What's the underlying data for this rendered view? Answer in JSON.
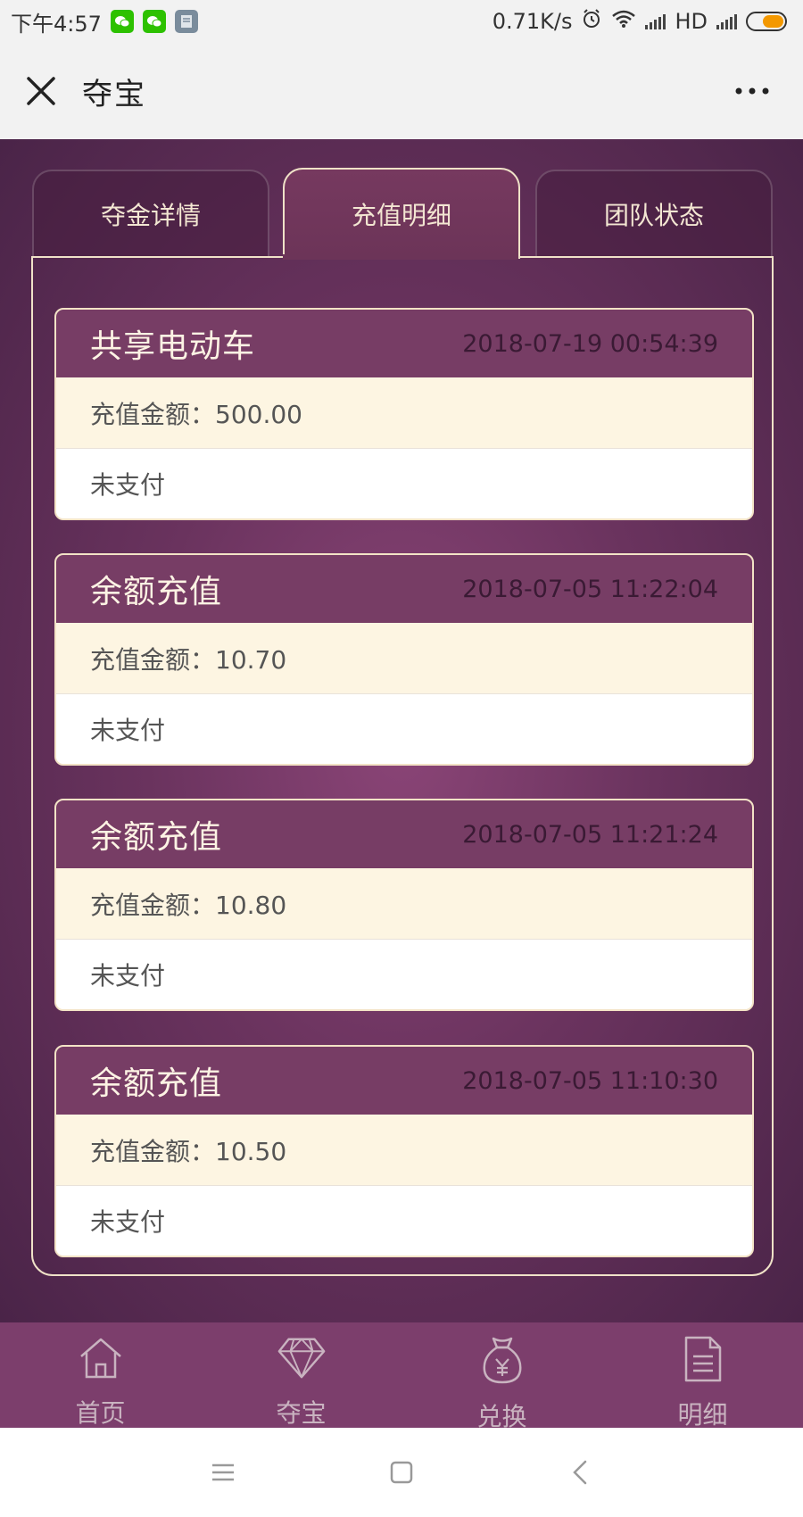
{
  "status_bar": {
    "time": "下午4:57",
    "network_speed": "0.71K/s",
    "network_type": "HD"
  },
  "title_bar": {
    "title": "夺宝"
  },
  "tabs": [
    {
      "label": "夺金详情",
      "active": false
    },
    {
      "label": "充值明细",
      "active": true
    },
    {
      "label": "团队状态",
      "active": false
    }
  ],
  "records": [
    {
      "title": "共享电动车",
      "time": "2018-07-19 00:54:39",
      "amount": "充值金额：500.00",
      "status": "未支付"
    },
    {
      "title": "余额充值",
      "time": "2018-07-05 11:22:04",
      "amount": "充值金额：10.70",
      "status": "未支付"
    },
    {
      "title": "余额充值",
      "time": "2018-07-05 11:21:24",
      "amount": "充值金额：10.80",
      "status": "未支付"
    },
    {
      "title": "余额充值",
      "time": "2018-07-05 11:10:30",
      "amount": "充值金额：10.50",
      "status": "未支付"
    }
  ],
  "bottom_nav": [
    {
      "label": "首页",
      "icon": "home-icon"
    },
    {
      "label": "夺宝",
      "icon": "diamond-icon"
    },
    {
      "label": "兑换",
      "icon": "money-bag-icon"
    },
    {
      "label": "明细",
      "icon": "document-icon"
    }
  ],
  "colors": {
    "purple_bg": "#6a335e",
    "card_header": "#773d65",
    "card_amount_bg": "#fdf5e2",
    "nav_bg": "#7c3e6c",
    "cream_border": "#f0e2c8"
  }
}
